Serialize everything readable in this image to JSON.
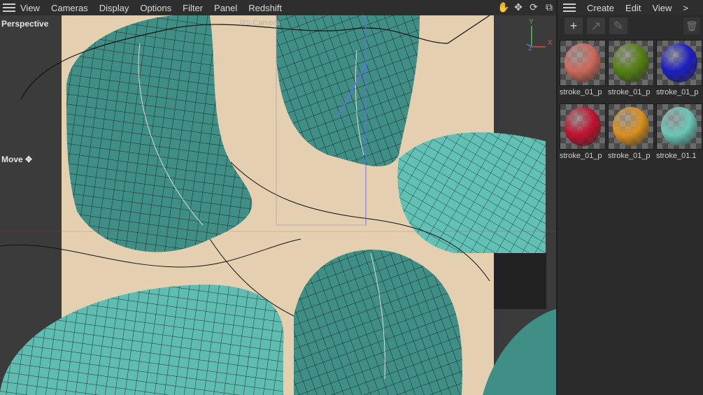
{
  "menubar": {
    "items": [
      "View",
      "Cameras",
      "Display",
      "Options",
      "Filter",
      "Panel",
      "Redshift"
    ]
  },
  "viewport": {
    "name": "Perspective",
    "camera": "RS Camera",
    "tool": "Move",
    "axis_labels": {
      "y": "Y",
      "x": "X",
      "z": "Z"
    },
    "colors": {
      "background": "#e4cfb0",
      "surface": "#3f8f86",
      "wire": "#111111"
    }
  },
  "material_manager": {
    "menu": [
      "Create",
      "Edit",
      "View"
    ],
    "more": ">",
    "materials": [
      {
        "name": "stroke_01_p",
        "color": "#cc6a5a"
      },
      {
        "name": "stroke_01_p",
        "color": "#557f12"
      },
      {
        "name": "stroke_01_p",
        "color": "#1c1ec2"
      },
      {
        "name": "stroke_01_p",
        "color": "#c0122e"
      },
      {
        "name": "stroke_01_p",
        "color": "#d99020"
      },
      {
        "name": "stroke_01.1",
        "color": "#6cc6b6"
      }
    ]
  }
}
